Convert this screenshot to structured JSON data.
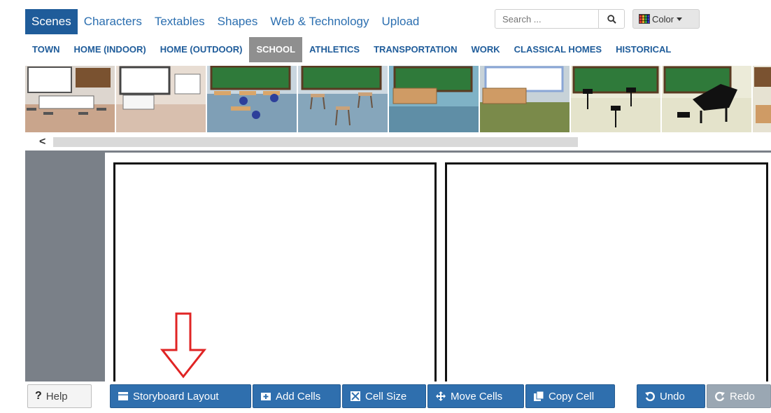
{
  "tabs": [
    {
      "label": "Scenes",
      "active": true
    },
    {
      "label": "Characters"
    },
    {
      "label": "Textables"
    },
    {
      "label": "Shapes"
    },
    {
      "label": "Web & Technology"
    },
    {
      "label": "Upload"
    }
  ],
  "search": {
    "placeholder": "Search ...",
    "icon": "search-icon"
  },
  "color_button": {
    "label": "Color",
    "icon": "color-grid-icon"
  },
  "categories": [
    {
      "label": "TOWN"
    },
    {
      "label": "HOME (INDOOR)"
    },
    {
      "label": "HOME (OUTDOOR)"
    },
    {
      "label": "SCHOOL",
      "active": true
    },
    {
      "label": "ATHLETICS"
    },
    {
      "label": "TRANSPORTATION"
    },
    {
      "label": "WORK"
    },
    {
      "label": "CLASSICAL HOMES"
    },
    {
      "label": "HISTORICAL"
    }
  ],
  "toolbar": {
    "help": "Help",
    "storyboard_layout": "Storyboard Layout",
    "add_cells": "Add Cells",
    "cell_size": "Cell Size",
    "move_cells": "Move Cells",
    "copy_cell": "Copy Cell",
    "undo": "Undo",
    "redo": "Redo"
  },
  "colors": {
    "accent": "#1f5c9a",
    "button_blue": "#2f6fae",
    "arrow_red": "#e02424",
    "work_area": "#7a8088"
  }
}
